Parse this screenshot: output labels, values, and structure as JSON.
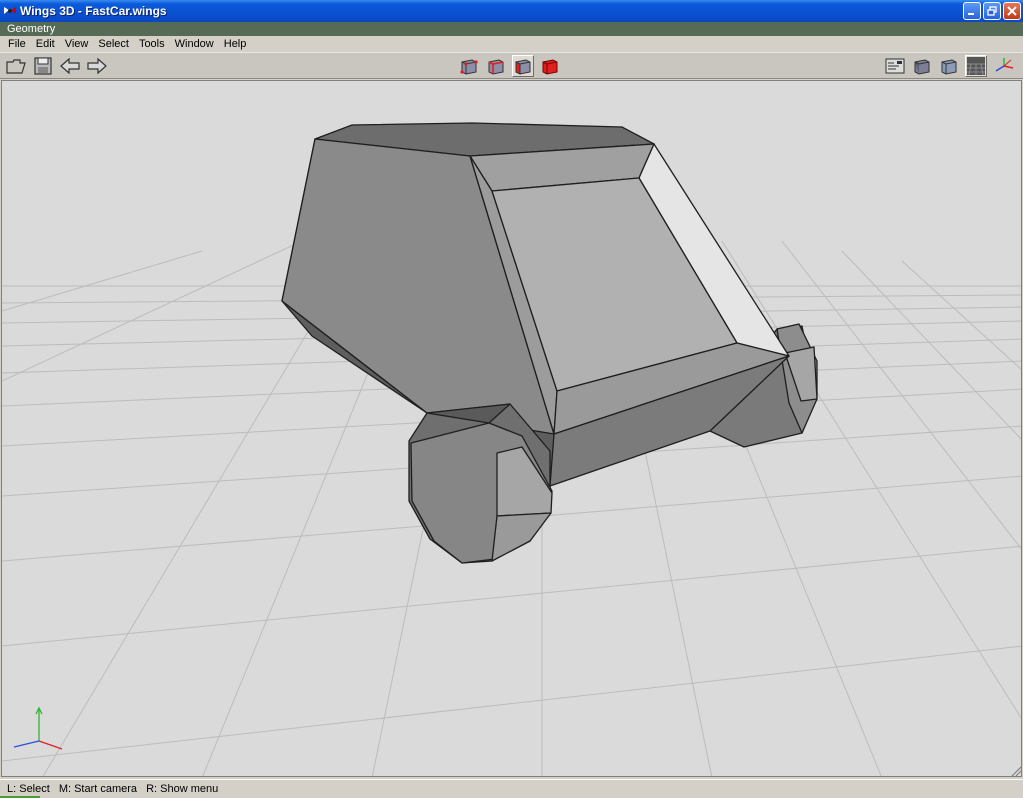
{
  "window": {
    "title": "Wings 3D - FastCar.wings"
  },
  "geometry_bar": {
    "label": "Geometry"
  },
  "menu": [
    "File",
    "Edit",
    "View",
    "Select",
    "Tools",
    "Window",
    "Help"
  ],
  "toolbar": {
    "left_icons": [
      "open-folder-icon",
      "save-icon",
      "undo-arrow-icon",
      "redo-arrow-icon"
    ],
    "selection_modes": [
      "vertex-mode-icon",
      "edge-mode-icon",
      "face-mode-icon",
      "body-mode-icon"
    ],
    "active_selection_mode": "face-mode-icon",
    "right_icons": [
      "outliner-icon",
      "smooth-shading-icon",
      "flat-shading-icon",
      "ground-plane-icon",
      "axes-icon"
    ]
  },
  "colors": {
    "title_bar": "#0a4fd0",
    "geometry_bar": "#556b55",
    "viewport_bg": "#dadada",
    "grid": "#bdbdbd",
    "select_red": "#e01f1f"
  },
  "status": {
    "segments": [
      "L: Select",
      "M: Start camera",
      "R: Show menu"
    ]
  }
}
